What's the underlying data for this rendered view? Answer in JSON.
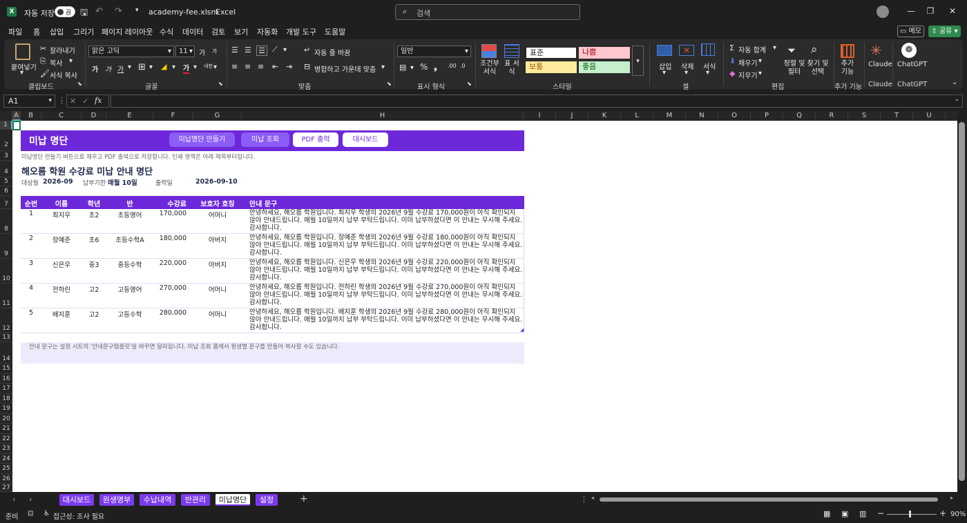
{
  "titlebar": {
    "autosave_label": "자동 저장",
    "autosave_state": "끔",
    "filename": "academy-fee.xlsm",
    "app": "Excel",
    "search_placeholder": "검색"
  },
  "menu": [
    "파일",
    "홈",
    "삽입",
    "그리기",
    "페이지 레이아웃",
    "수식",
    "데이터",
    "검토",
    "보기",
    "자동화",
    "개발 도구",
    "도움말"
  ],
  "menu_right": {
    "comment": "메모",
    "share": "공유"
  },
  "ribbon": {
    "clipboard": {
      "paste": "붙여넣기",
      "cut": "잘라내기",
      "copy": "복사",
      "format_painter": "서식 복사",
      "label": "클립보드"
    },
    "font": {
      "name": "맑은 고딕",
      "size": "11",
      "label": "글꼴",
      "bold": "가",
      "italic": "가",
      "underline": "가",
      "grow": "가",
      "shrink": "가",
      "font_color": "가",
      "phonetic": "내천"
    },
    "alignment": {
      "wrap": "자동 줄 바꿈",
      "merge": "병합하고 가운데 맞춤",
      "label": "맞춤"
    },
    "number": {
      "format": "일반",
      "label": "표시 형식"
    },
    "styles": {
      "conditional": "조건부 서식",
      "table": "표 서식",
      "normal": "표준",
      "bad": "나쁨",
      "neutral": "보통",
      "good": "좋음",
      "label": "스타일"
    },
    "cells": {
      "insert": "삽입",
      "delete": "삭제",
      "format": "서식",
      "label": "셀"
    },
    "editing": {
      "autosum": "자동 합계",
      "fill": "채우기",
      "clear": "지우기",
      "sort": "정렬 및 필터",
      "find": "찾기 및 선택",
      "label": "편집"
    },
    "addins": {
      "label": "추가 기능",
      "btn": "추가 기능"
    },
    "claude": {
      "label": "Claude",
      "btn": "Claude"
    },
    "chatgpt": {
      "label": "ChatGPT",
      "btn": "ChatGPT"
    },
    "colors": {
      "bad_bg": "#ffc7ce",
      "bad_fg": "#9c0006",
      "neutral_bg": "#ffeb9c",
      "neutral_fg": "#9c5700",
      "good_bg": "#c6efce",
      "good_fg": "#006100"
    }
  },
  "formula_bar": {
    "namebox": "A1",
    "fx": "fx",
    "content": ""
  },
  "columns": [
    "A",
    "B",
    "C",
    "D",
    "E",
    "F",
    "G",
    "H",
    "I",
    "J",
    "K",
    "L",
    "M",
    "N",
    "O",
    "P",
    "Q",
    "R",
    "S",
    "T",
    "U"
  ],
  "rows": [
    "1",
    "2",
    "3",
    "4",
    "5",
    "6",
    "7",
    "8",
    "9",
    "10",
    "11",
    "12",
    "13",
    "14",
    "15",
    "16",
    "17",
    "18",
    "19",
    "20",
    "21",
    "22",
    "23",
    "24",
    "25",
    "26",
    "27"
  ],
  "sheet": {
    "banner_title": "미납 명단",
    "buttons": [
      "미납명단 만들기",
      "미납 조회",
      "PDF 출력",
      "대시보드"
    ],
    "hint": "미납명단 만들기 버튼으로 채우고 PDF 출력으로 저장합니다. 인쇄 영역은 아래 제목부터입니다.",
    "title": "해오름 학원 수강료 미납 안내 명단",
    "meta": {
      "period_label": "대상월",
      "period": "2026-09",
      "due_label": "납부기한",
      "due": "매월 10일",
      "print_label": "출력일",
      "print_date": "2026-09-10"
    },
    "table_headers": [
      "순번",
      "이름",
      "학년",
      "반",
      "수강료",
      "보호자 호칭",
      "안내 문구"
    ],
    "table_rows": [
      {
        "no": "1",
        "name": "최지우",
        "grade": "초2",
        "class": "초등영어",
        "fee": "170,000",
        "guardian": "어머니",
        "msg": "안녕하세요, 해오름 학원입니다. 최지우 학생의 2026년 9월 수강료 170,000원이 아직 확인되지 않아 안내드립니다. 매월 10일까지 납부 부탁드립니다. 이미 납부하셨다면 이 안내는 무시해 주세요. 감사합니다."
      },
      {
        "no": "2",
        "name": "장예준",
        "grade": "초6",
        "class": "초등수학A",
        "fee": "180,000",
        "guardian": "아버지",
        "msg": "안녕하세요, 해오름 학원입니다. 장예준 학생의 2026년 9월 수강료 180,000원이 아직 확인되지 않아 안내드립니다. 매월 10일까지 납부 부탁드립니다. 이미 납부하셨다면 이 안내는 무시해 주세요. 감사합니다."
      },
      {
        "no": "3",
        "name": "신은우",
        "grade": "중3",
        "class": "중등수학",
        "fee": "220,000",
        "guardian": "아버지",
        "msg": "안녕하세요, 해오름 학원입니다. 신은우 학생의 2026년 9월 수강료 220,000원이 아직 확인되지 않아 안내드립니다. 매월 10일까지 납부 부탁드립니다. 이미 납부하셨다면 이 안내는 무시해 주세요. 감사합니다."
      },
      {
        "no": "4",
        "name": "전하린",
        "grade": "고2",
        "class": "고등영어",
        "fee": "270,000",
        "guardian": "어머니",
        "msg": "안녕하세요, 해오름 학원입니다. 전하린 학생의 2026년 9월 수강료 270,000원이 아직 확인되지 않아 안내드립니다. 매월 10일까지 납부 부탁드립니다. 이미 납부하셨다면 이 안내는 무시해 주세요. 감사합니다."
      },
      {
        "no": "5",
        "name": "배지훈",
        "grade": "고2",
        "class": "고등수학",
        "fee": "280,000",
        "guardian": "어머니",
        "msg": "안녕하세요, 해오름 학원입니다. 배지훈 학생의 2026년 9월 수강료 280,000원이 아직 확인되지 않아 안내드립니다. 매월 10일까지 납부 부탁드립니다. 이미 납부하셨다면 이 안내는 무시해 주세요. 감사합니다."
      }
    ],
    "footnote": "안내 문구는 설정 시트의 '안내문구템플릿'을 바꾸면 달라집니다. 미납 조회 폼에서 원생별 문구를 만들어 복사할 수도 있습니다."
  },
  "tabs": [
    "대시보드",
    "원생명부",
    "수납내역",
    "반관리",
    "미납명단",
    "설정"
  ],
  "active_tab": "미납명단",
  "status": {
    "ready": "준비",
    "accessibility": "접근성: 조사 필요",
    "zoom": "90%"
  },
  "accent_color": "#6d28d9"
}
